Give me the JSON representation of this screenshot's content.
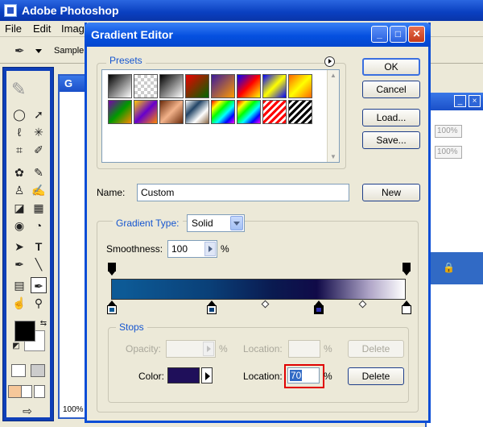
{
  "app": {
    "title": "Adobe Photoshop"
  },
  "menu": [
    "File",
    "Edit",
    "Imag"
  ],
  "options_bar": {
    "sample_label": "Sample S"
  },
  "background_windows": {
    "doc_title": "G",
    "doc_title_left": "G",
    "right_panel_values": [
      "100%",
      "100%"
    ],
    "zoom": "100%"
  },
  "dialog": {
    "title": "Gradient Editor",
    "presets_label": "Presets",
    "buttons": {
      "ok": "OK",
      "cancel": "Cancel",
      "load": "Load...",
      "save": "Save...",
      "new": "New"
    },
    "name_label": "Name:",
    "name_value": "Custom",
    "gradient_type_label": "Gradient Type:",
    "gradient_type_value": "Solid",
    "smoothness_label": "Smoothness:",
    "smoothness_value": "100",
    "smoothness_unit": "%",
    "stops_label": "Stops",
    "opacity_label": "Opacity:",
    "opacity_value": "",
    "opacity_unit": "%",
    "opacity_location_label": "Location:",
    "opacity_location_value": "",
    "opacity_location_unit": "%",
    "opacity_delete": "Delete",
    "color_label": "Color:",
    "color_value": "#1f0f5a",
    "color_location_label": "Location:",
    "color_location_value": "70",
    "color_location_unit": "%",
    "color_delete": "Delete"
  },
  "presets": [
    "#000000 to #ffffff",
    "transparent",
    "black-white",
    "red-green",
    "violet-orange",
    "blue-red-yellow",
    "blue-yellow-blue",
    "orange-yellow",
    "violet-green-orange",
    "yellow-violet-orange",
    "copper",
    "chrome",
    "spectrum",
    "transparent-rainbow",
    "transparent-stripes"
  ],
  "tools": [
    "marquee-icon",
    "move-icon",
    "lasso-icon",
    "magic-wand-icon",
    "crop-icon",
    "slice-icon",
    "healing-icon",
    "brush-icon",
    "stamp-icon",
    "history-brush-icon",
    "eraser-icon",
    "gradient-icon",
    "blur-icon",
    "dodge-icon",
    "path-select-icon",
    "type-icon",
    "pen-icon",
    "line-icon",
    "notes-icon",
    "eyedropper-icon",
    "hand-icon",
    "zoom-icon"
  ]
}
